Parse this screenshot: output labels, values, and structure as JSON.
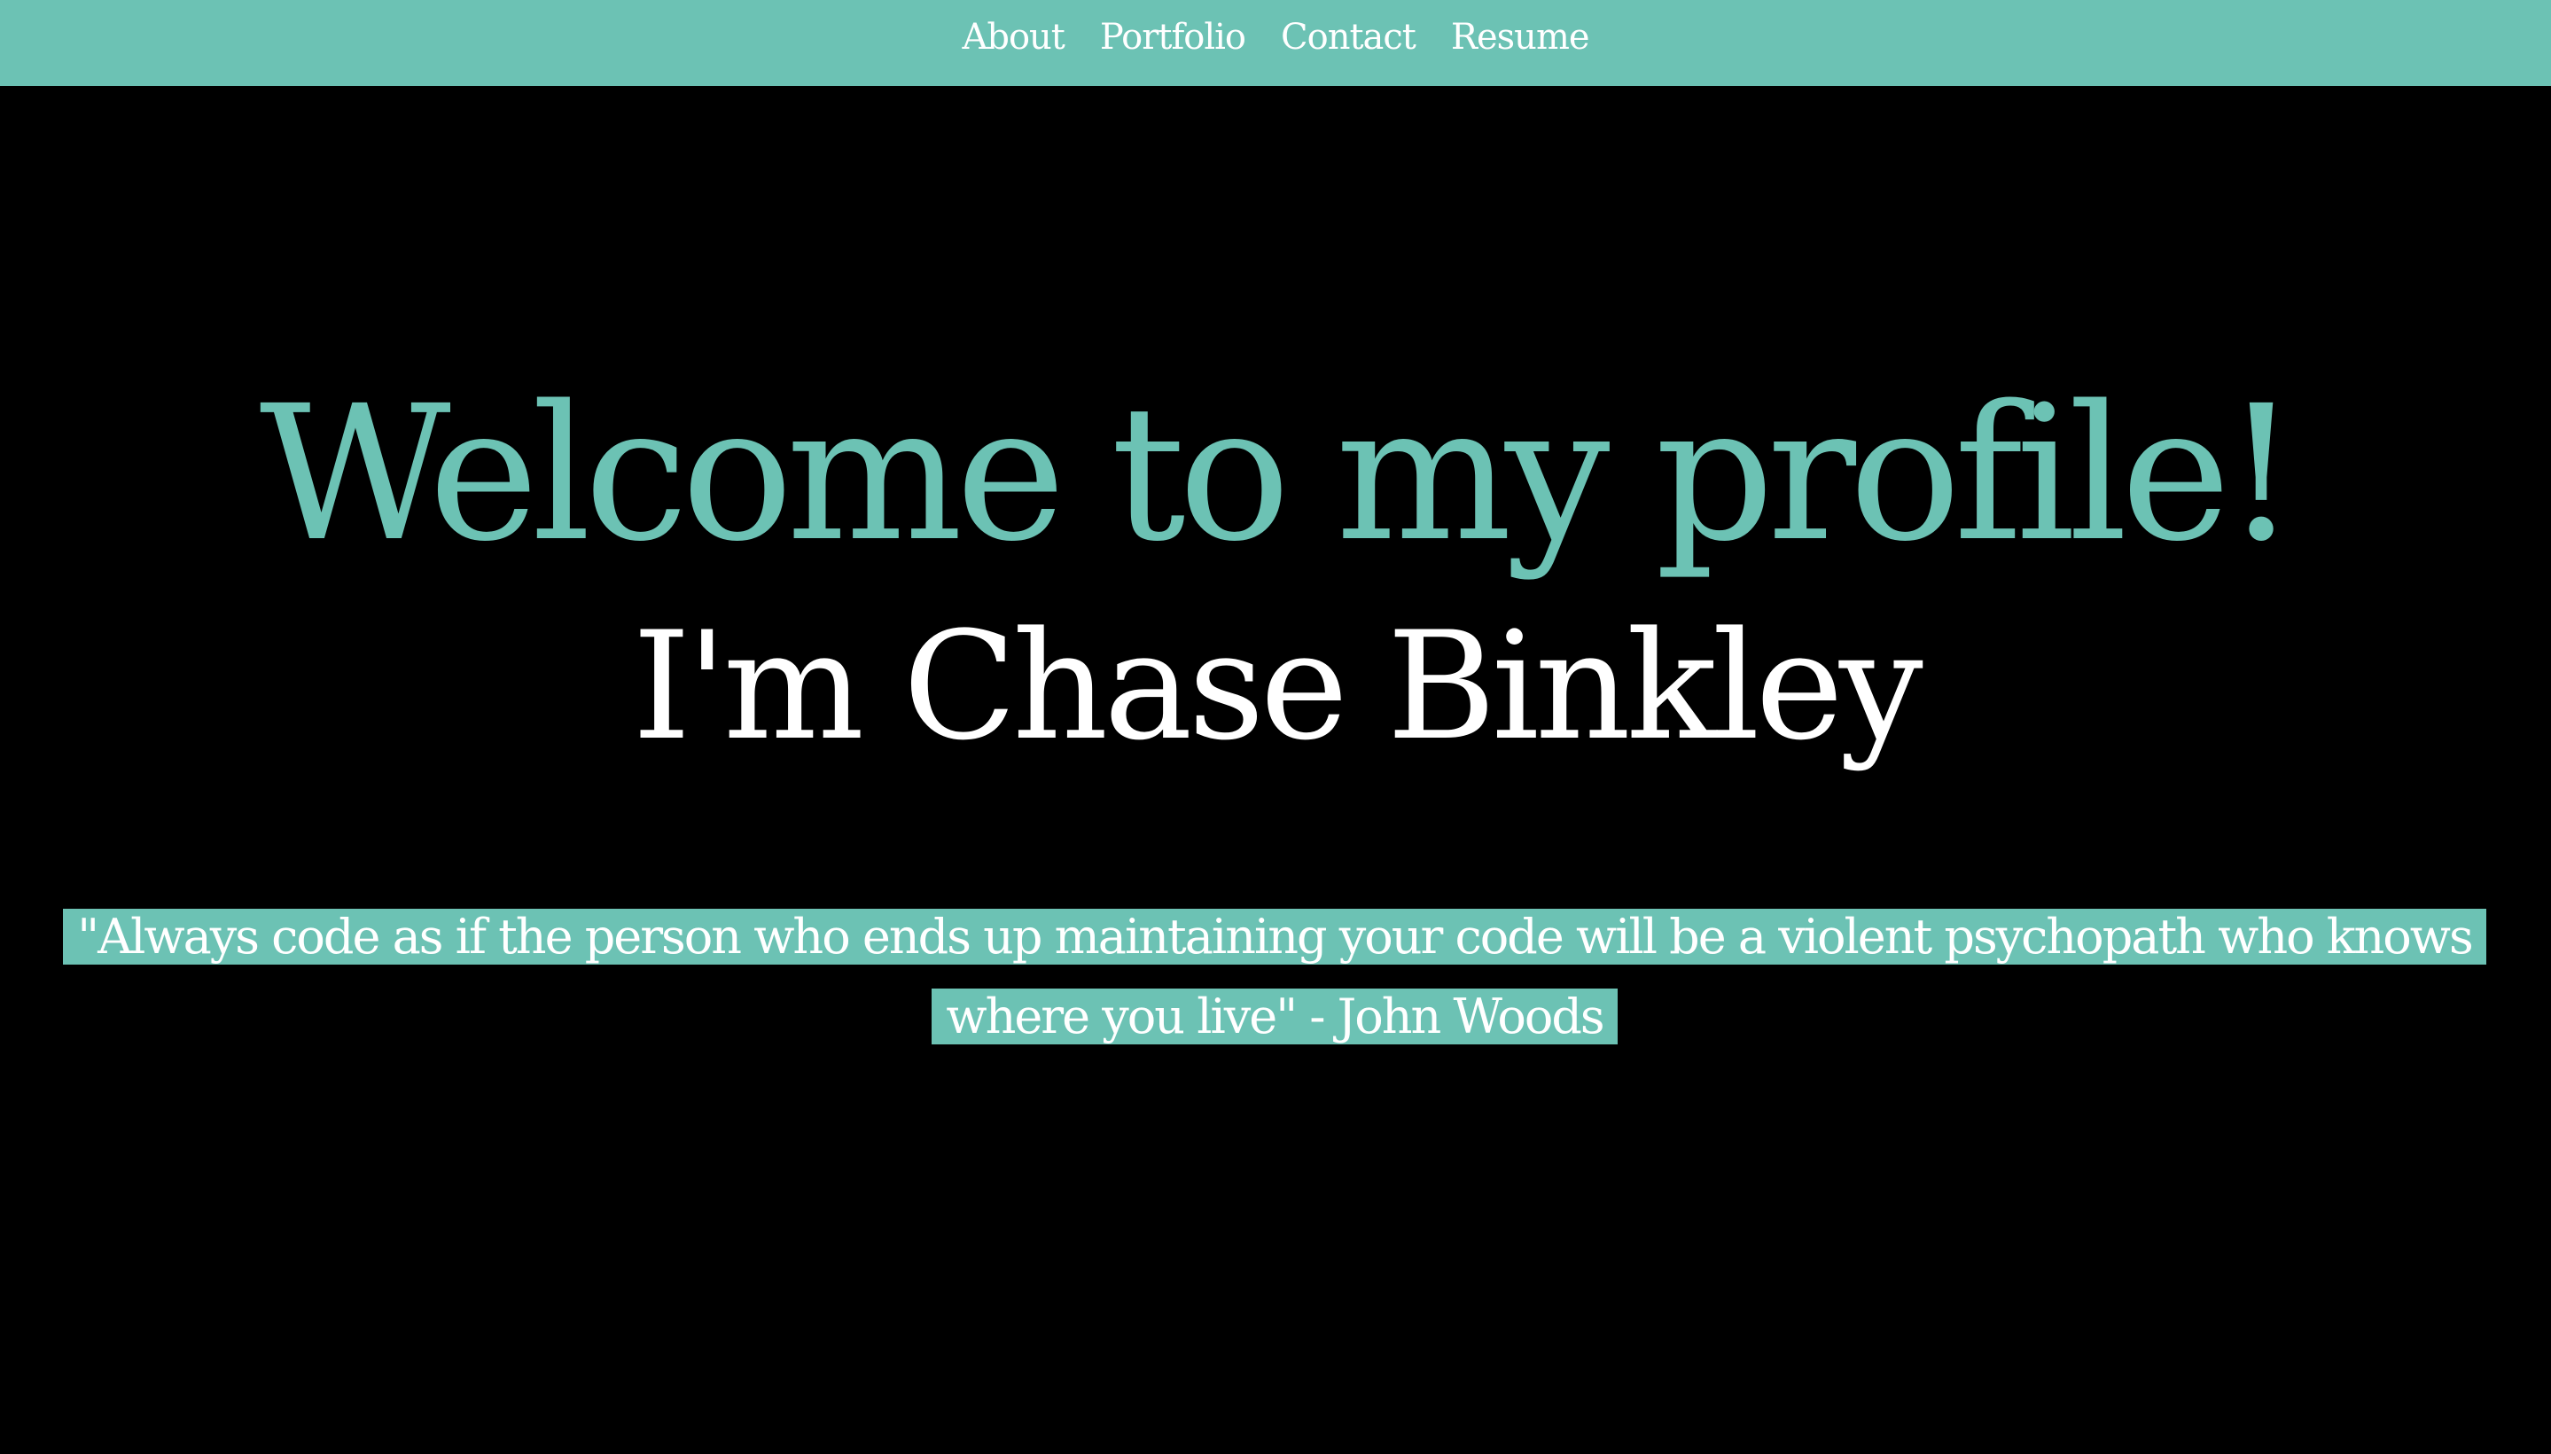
{
  "nav": {
    "links": [
      {
        "label": "About"
      },
      {
        "label": "Portfolio"
      },
      {
        "label": "Contact"
      },
      {
        "label": "Resume"
      }
    ]
  },
  "hero": {
    "heading": "Welcome to my profile!",
    "subheading": "I'm Chase Binkley"
  },
  "quote": {
    "text": "\"Always code as if the person who ends up maintaining your code will be a violent psychopath who knows where you live\" - John Woods"
  },
  "colors": {
    "accent": "#6cc2b4",
    "background": "#000000",
    "text": "#ffffff"
  }
}
